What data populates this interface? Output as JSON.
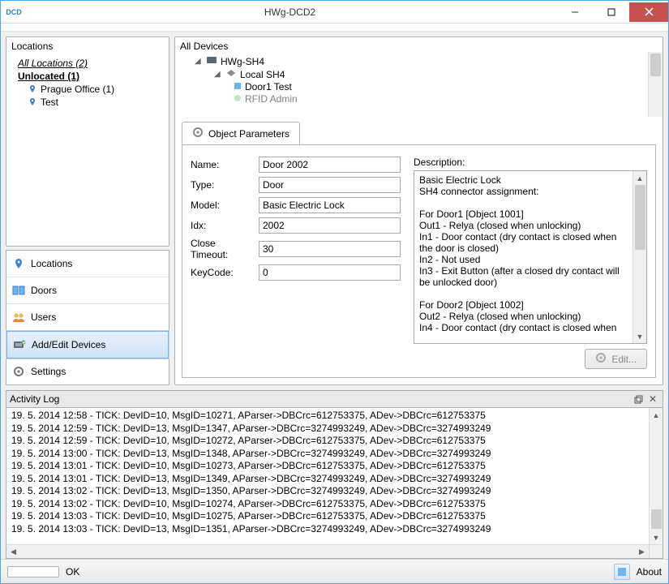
{
  "window": {
    "appIconText": "DCD",
    "title": "HWg-DCD2"
  },
  "locations": {
    "header": "Locations",
    "allLocations": "All Locations (2)",
    "unlocated": "Unlocated (1)",
    "children": [
      {
        "label": "Prague Office (1)"
      },
      {
        "label": "Test"
      }
    ]
  },
  "nav": {
    "locations": "Locations",
    "doors": "Doors",
    "users": "Users",
    "addEdit": "Add/Edit Devices",
    "settings": "Settings"
  },
  "devices": {
    "header": "All Devices",
    "root": "HWg-SH4",
    "local": "Local SH4",
    "leafs": [
      "Door1 Test",
      "RFID Admin"
    ]
  },
  "tabs": {
    "objectParams": "Object Parameters"
  },
  "form": {
    "nameLabel": "Name:",
    "nameValue": "Door 2002",
    "typeLabel": "Type:",
    "typeValue": "Door",
    "modelLabel": "Model:",
    "modelValue": "Basic Electric Lock",
    "idxLabel": "Idx:",
    "idxValue": "2002",
    "closeTimeoutLabel": "Close Timeout:",
    "closeTimeoutValue": "30",
    "keyCodeLabel": "KeyCode:",
    "keyCodeValue": "0",
    "descriptionLabel": "Description:",
    "descriptionLines": [
      "Basic Electric Lock",
      "SH4 connector assignment:",
      "",
      "For Door1 [Object 1001]",
      "Out1 - Relya (closed when unlocking)",
      "In1 - Door contact (dry contact is closed when the door is closed)",
      "In2 - Not used",
      "In3 - Exit Button (after a closed dry contact will be unlocked door)",
      "",
      "For Door2 [Object 1002]",
      "Out2 - Relya (closed when unlocking)",
      "In4 - Door contact (dry contact is closed when"
    ],
    "editBtn": "Edit..."
  },
  "log": {
    "header": "Activity Log",
    "lines": [
      "19. 5. 2014 12:58 - TICK: DevID=10, MsgID=10271, AParser->DBCrc=612753375, ADev->DBCrc=612753375",
      "19. 5. 2014 12:59 - TICK: DevID=13, MsgID=1347, AParser->DBCrc=3274993249, ADev->DBCrc=3274993249",
      "19. 5. 2014 12:59 - TICK: DevID=10, MsgID=10272, AParser->DBCrc=612753375, ADev->DBCrc=612753375",
      "19. 5. 2014 13:00 - TICK: DevID=13, MsgID=1348, AParser->DBCrc=3274993249, ADev->DBCrc=3274993249",
      "19. 5. 2014 13:01 - TICK: DevID=10, MsgID=10273, AParser->DBCrc=612753375, ADev->DBCrc=612753375",
      "19. 5. 2014 13:01 - TICK: DevID=13, MsgID=1349, AParser->DBCrc=3274993249, ADev->DBCrc=3274993249",
      "19. 5. 2014 13:02 - TICK: DevID=13, MsgID=1350, AParser->DBCrc=3274993249, ADev->DBCrc=3274993249",
      "19. 5. 2014 13:02 - TICK: DevID=10, MsgID=10274, AParser->DBCrc=612753375, ADev->DBCrc=612753375",
      "19. 5. 2014 13:03 - TICK: DevID=10, MsgID=10275, AParser->DBCrc=612753375, ADev->DBCrc=612753375",
      "19. 5. 2014 13:03 - TICK: DevID=13, MsgID=1351, AParser->DBCrc=3274993249, ADev->DBCrc=3274993249"
    ]
  },
  "status": {
    "ok": "OK",
    "about": "About"
  }
}
